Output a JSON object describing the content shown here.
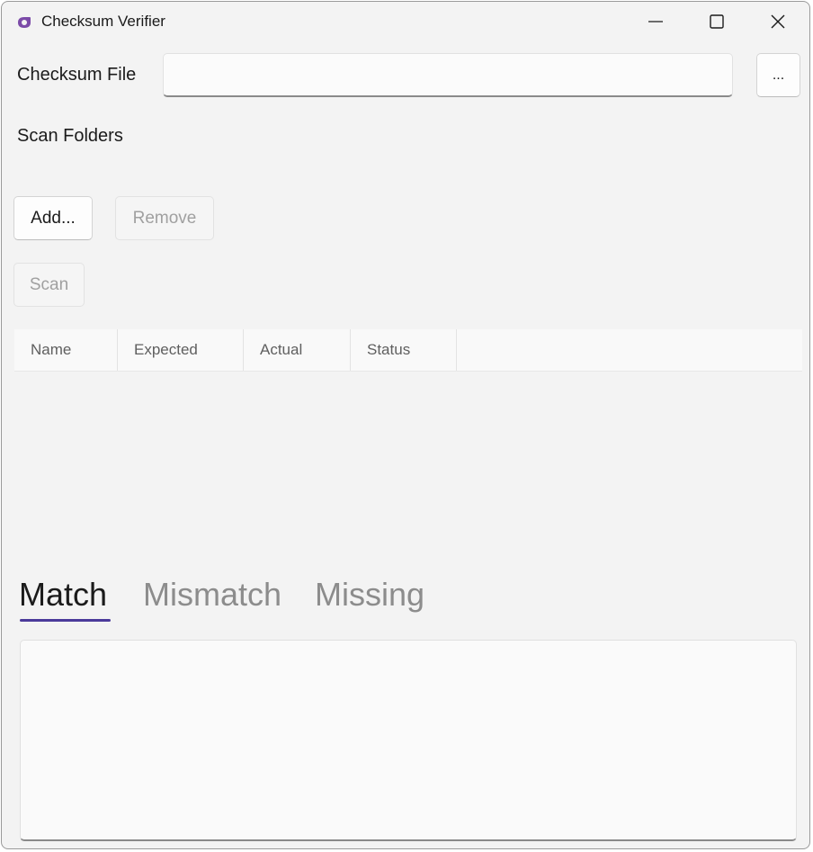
{
  "window": {
    "title": "Checksum Verifier"
  },
  "icons": {
    "app": "app-logo-icon",
    "minimize": "minimize-icon",
    "maximize": "maximize-icon",
    "close": "close-icon"
  },
  "checksum_file": {
    "label": "Checksum File",
    "value": "",
    "placeholder": "",
    "browse_label": "..."
  },
  "scan_folders": {
    "label": "Scan Folders",
    "add_label": "Add...",
    "remove_label": "Remove",
    "scan_label": "Scan"
  },
  "grid": {
    "columns": [
      "Name",
      "Expected",
      "Actual",
      "Status"
    ],
    "rows": []
  },
  "tabs": [
    {
      "label": "Match",
      "selected": true
    },
    {
      "label": "Mismatch",
      "selected": false
    },
    {
      "label": "Missing",
      "selected": false
    }
  ],
  "colors": {
    "accent": "#4b3a9a",
    "window_bg": "#f3f3f3",
    "app_icon": "#7b4aa8"
  }
}
